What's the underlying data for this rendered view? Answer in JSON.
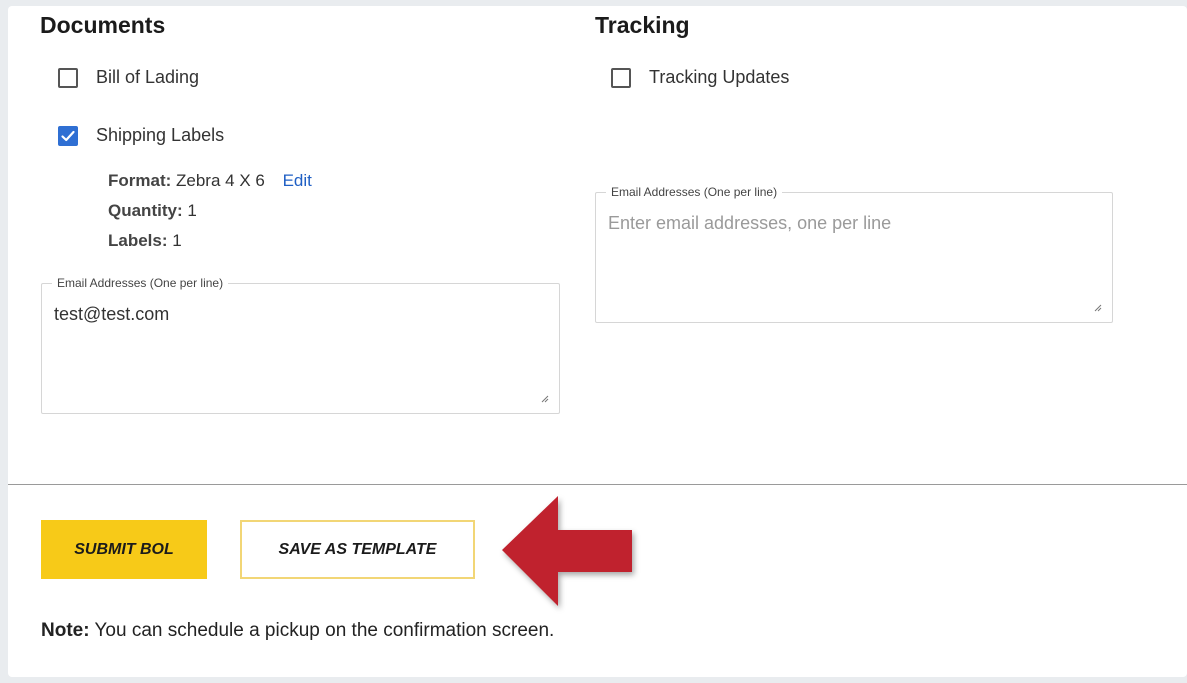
{
  "documents": {
    "title": "Documents",
    "checkboxes": [
      {
        "label": "Bill of Lading",
        "checked": false
      },
      {
        "label": "Shipping Labels",
        "checked": true
      }
    ],
    "label_details": {
      "format_label": "Format:",
      "format_value": "Zebra 4 X 6",
      "edit_link": "Edit",
      "quantity_label": "Quantity:",
      "quantity_value": "1",
      "labels_label": "Labels:",
      "labels_value": "1"
    },
    "email_field": {
      "legend": "Email Addresses (One per line)",
      "value": "test@test.com",
      "placeholder": ""
    }
  },
  "tracking": {
    "title": "Tracking",
    "checkboxes": [
      {
        "label": "Tracking Updates",
        "checked": false
      }
    ],
    "email_field": {
      "legend": "Email Addresses (One per line)",
      "value": "",
      "placeholder": "Enter email addresses, one per line"
    }
  },
  "actions": {
    "submit_label": "SUBMIT BOL",
    "save_template_label": "SAVE AS TEMPLATE"
  },
  "note": {
    "prefix": "Note:",
    "text": " You can schedule a pickup on the confirmation screen."
  },
  "colors": {
    "accent_yellow": "#f7ca18",
    "checkbox_blue": "#2f6fd3",
    "link_blue": "#1f5fc4",
    "arrow_red": "#c0232f"
  }
}
